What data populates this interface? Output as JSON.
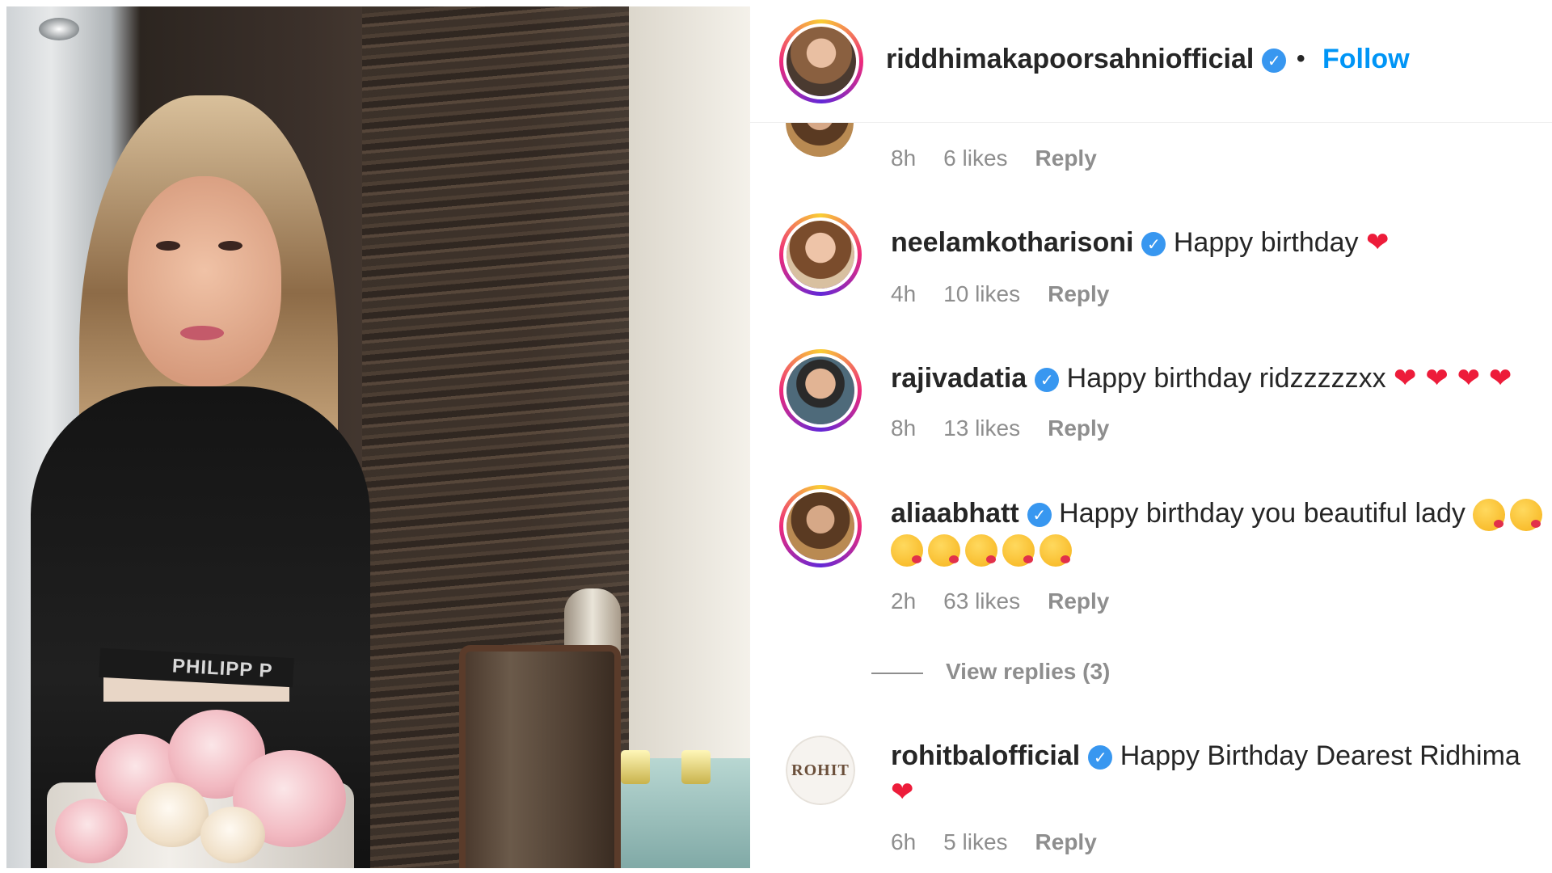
{
  "post": {
    "username": "riddhimakapoorsahniofficial",
    "separator": "•",
    "follow_label": "Follow",
    "photo_alt": "Woman in black top with floral cake",
    "band_text": "PHILIPP P"
  },
  "partial_comment": {
    "time": "8h",
    "likes": "6 likes",
    "reply": "Reply"
  },
  "comments": [
    {
      "username": "neelamkotharisoni",
      "text": "Happy birthday",
      "emoji": "❤",
      "time": "4h",
      "likes": "10 likes",
      "reply": "Reply"
    },
    {
      "username": "rajivadatia",
      "text": "Happy birthday ridzzzzzxx",
      "emoji": "❤ ❤ ❤ ❤",
      "time": "8h",
      "likes": "13 likes",
      "reply": "Reply"
    },
    {
      "username": "aliaabhatt",
      "text": "Happy birthday you beautiful lady",
      "time": "2h",
      "likes": "63 likes",
      "reply": "Reply"
    },
    {
      "username": "rohitbalofficial",
      "text": "Happy Birthday Dearest Ridhima",
      "emoji": "❤",
      "avatar_text": "ROHIT",
      "time": "6h",
      "likes": "5 likes",
      "reply": "Reply"
    }
  ],
  "view_replies": "View replies (3)",
  "colors": {
    "follow": "#0095f6",
    "verified": "#3897f0",
    "meta": "#8e8e8e",
    "heart": "#ed1c3a"
  }
}
